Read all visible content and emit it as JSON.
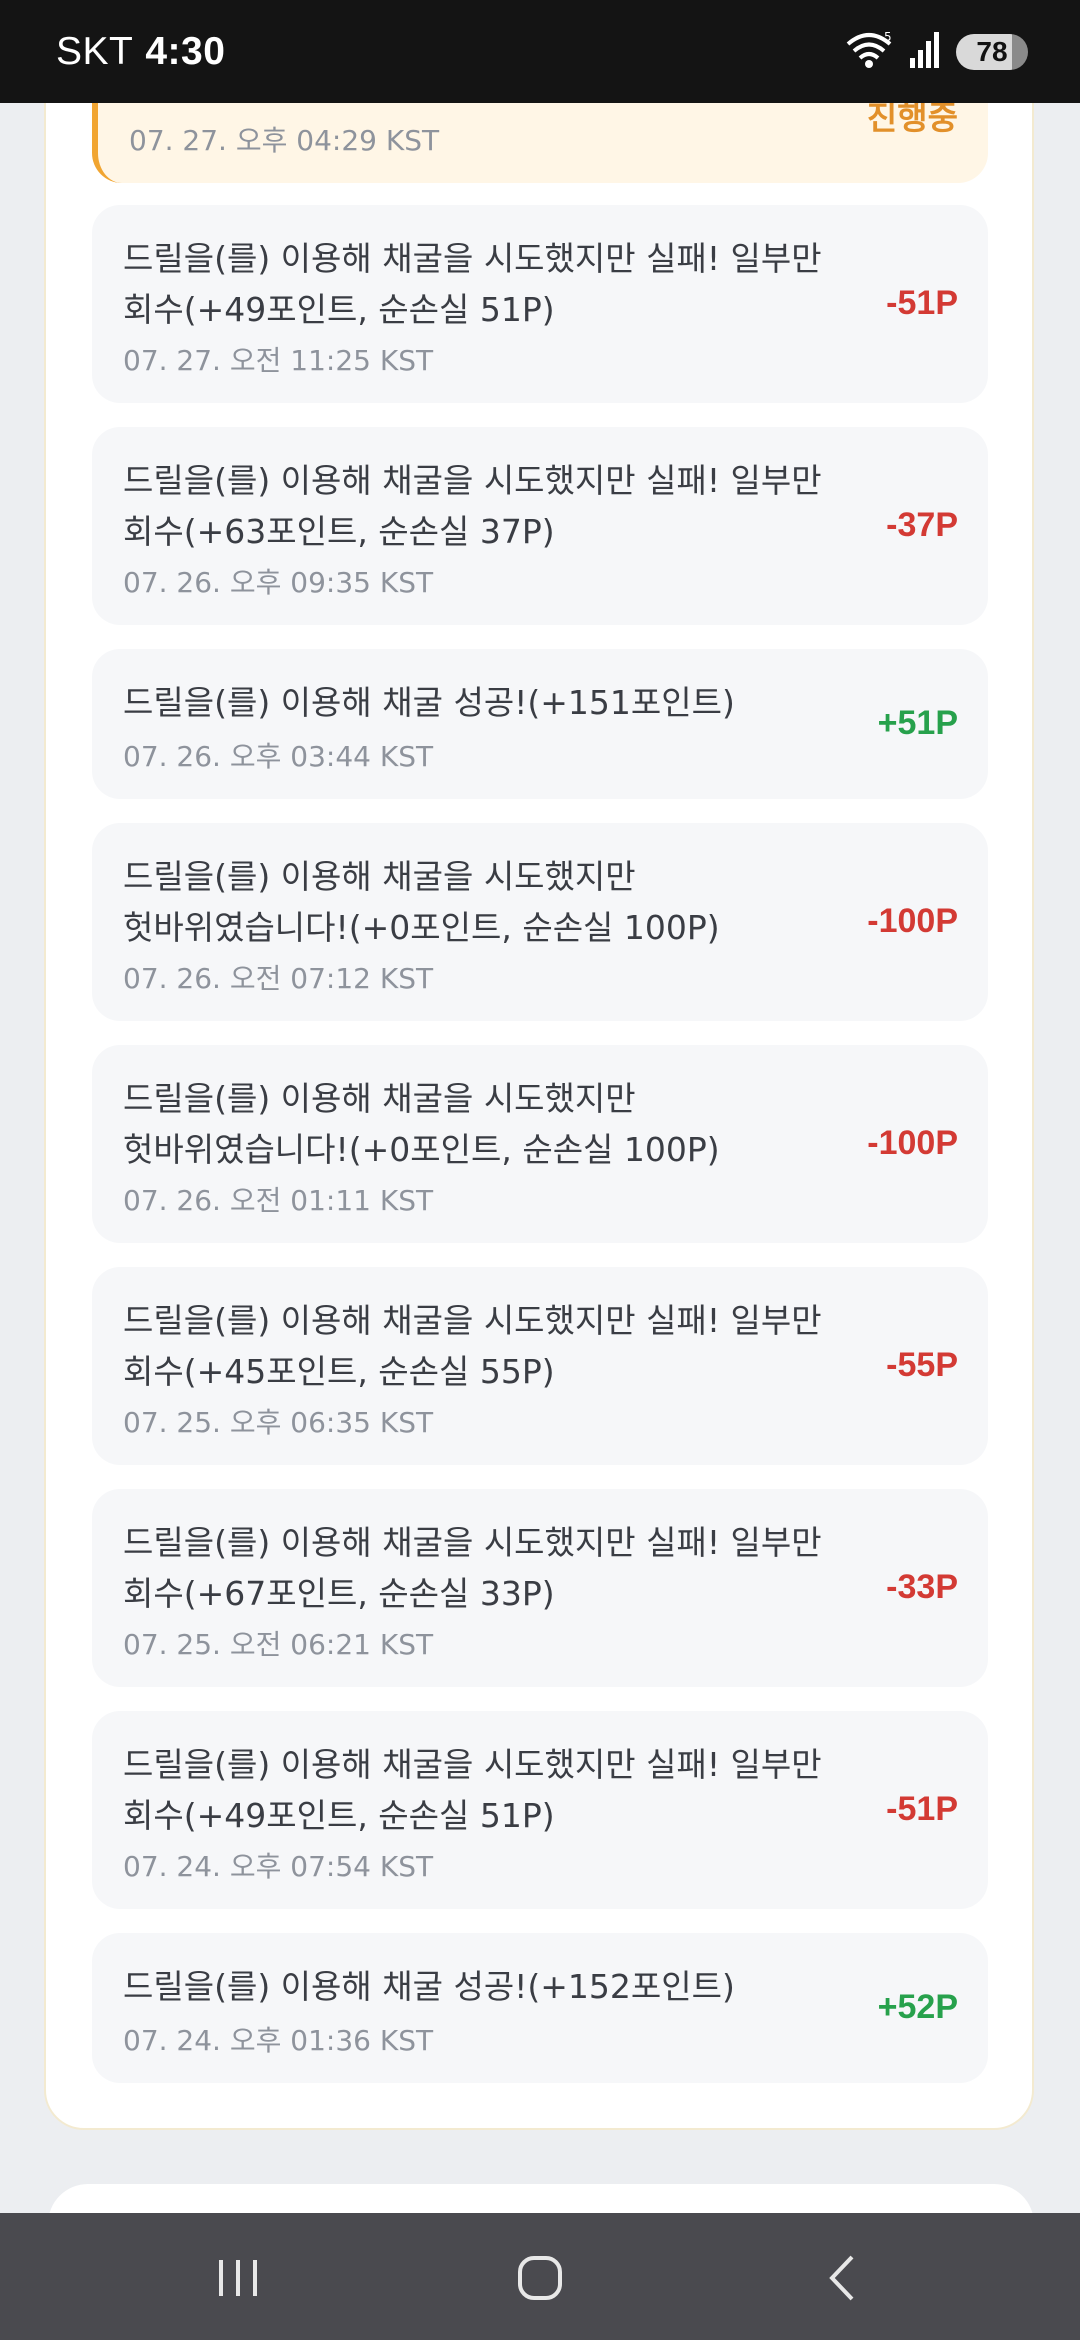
{
  "status_bar": {
    "carrier": "SKT",
    "time": "4:30",
    "battery": "78"
  },
  "top_item": {
    "date": "07. 27. 오후 04:29 KST",
    "status": "진행중"
  },
  "history": [
    {
      "text": "드릴을(를) 이용해 채굴을 시도했지만 실패! 일부만 회수(+49포인트, 순손실 51P)",
      "date": "07. 27. 오전 11:25 KST",
      "amount": "-51P",
      "sign": "neg"
    },
    {
      "text": "드릴을(를) 이용해 채굴을 시도했지만 실패! 일부만 회수(+63포인트, 순손실 37P)",
      "date": "07. 26. 오후 09:35 KST",
      "amount": "-37P",
      "sign": "neg"
    },
    {
      "text": "드릴을(를) 이용해 채굴 성공!(+151포인트)",
      "date": "07. 26. 오후 03:44 KST",
      "amount": "+51P",
      "sign": "pos"
    },
    {
      "text": "드릴을(를) 이용해 채굴을 시도했지만 헛바위였습니다!(+0포인트, 순손실 100P)",
      "date": "07. 26. 오전 07:12 KST",
      "amount": "-100P",
      "sign": "neg"
    },
    {
      "text": "드릴을(를) 이용해 채굴을 시도했지만 헛바위였습니다!(+0포인트, 순손실 100P)",
      "date": "07. 26. 오전 01:11 KST",
      "amount": "-100P",
      "sign": "neg"
    },
    {
      "text": "드릴을(를) 이용해 채굴을 시도했지만 실패! 일부만 회수(+45포인트, 순손실 55P)",
      "date": "07. 25. 오후 06:35 KST",
      "amount": "-55P",
      "sign": "neg"
    },
    {
      "text": "드릴을(를) 이용해 채굴을 시도했지만 실패! 일부만 회수(+67포인트, 순손실 33P)",
      "date": "07. 25. 오전 06:21 KST",
      "amount": "-33P",
      "sign": "neg"
    },
    {
      "text": "드릴을(를) 이용해 채굴을 시도했지만 실패! 일부만 회수(+49포인트, 순손실 51P)",
      "date": "07. 24. 오후 07:54 KST",
      "amount": "-51P",
      "sign": "neg"
    },
    {
      "text": "드릴을(를) 이용해 채굴 성공!(+152포인트)",
      "date": "07. 24. 오후 01:36 KST",
      "amount": "+52P",
      "sign": "pos"
    }
  ],
  "colors": {
    "negative": "#d33a34",
    "positive": "#27a14c",
    "in_progress": "#e2902a"
  }
}
